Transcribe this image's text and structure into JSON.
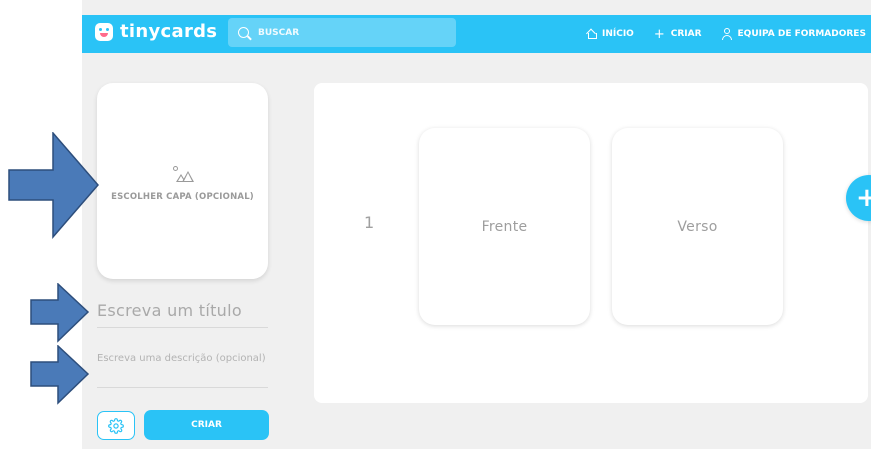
{
  "brand": {
    "name": "tinycards",
    "logo_icon": "tinycards-logo-icon"
  },
  "search": {
    "placeholder": "BUSCAR"
  },
  "nav": [
    {
      "label": "INÍCIO",
      "icon": "home-icon"
    },
    {
      "label": "CRIAR",
      "icon": "plus-icon"
    },
    {
      "label": "EQUIPA DE FORMADORES",
      "icon": "user-icon"
    }
  ],
  "cover": {
    "label": "ESCOLHER CAPA (OPCIONAL)",
    "icon": "image-icon"
  },
  "form": {
    "title_placeholder": "Escreva um título",
    "description_placeholder": "Escreva uma descrição (opcional)",
    "create_label": "CRIAR"
  },
  "card": {
    "number": "1",
    "front_label": "Frente",
    "back_label": "Verso"
  },
  "colors": {
    "accent": "#2ac3f6",
    "background": "#f0f0f0",
    "arrow": "#4a7ab8",
    "arrow_border": "#2d4e7c"
  }
}
